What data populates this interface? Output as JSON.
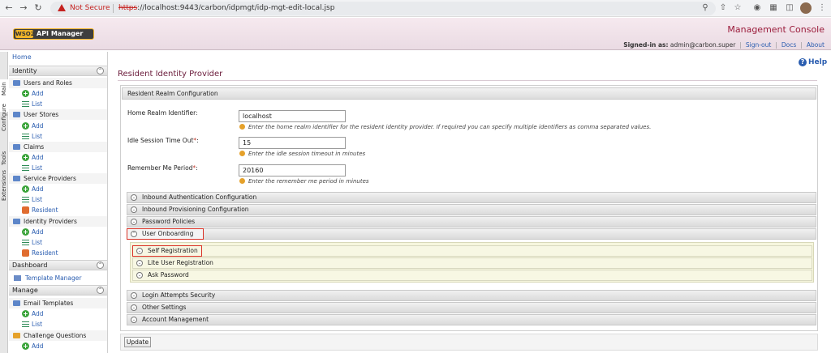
{
  "browser": {
    "not_secure": "Not Secure",
    "url_scheme": "https",
    "url_rest": "://localhost:9443/carbon/idpmgt/idp-mgt-edit-local.jsp"
  },
  "header": {
    "logo_wso2": "WSO2",
    "logo_product": "API Manager",
    "console_title": "Management Console",
    "signed_in_label": "Signed-in as:",
    "signed_in_user": "admin@carbon.super",
    "sign_out": "Sign-out",
    "docs": "Docs",
    "about": "About"
  },
  "vtabs": [
    "Main",
    "Configure",
    "Tools",
    "Extensions"
  ],
  "sidebar": {
    "home": "Home",
    "identity": "Identity",
    "users_and_roles": "Users and Roles",
    "user_stores": "User Stores",
    "claims": "Claims",
    "service_providers": "Service Providers",
    "identity_providers": "Identity Providers",
    "add": "Add",
    "list": "List",
    "resident": "Resident",
    "dashboard": "Dashboard",
    "template_manager": "Template Manager",
    "manage": "Manage",
    "email_templates": "Email Templates",
    "challenge_questions": "Challenge Questions"
  },
  "main": {
    "help": "Help",
    "page_title": "Resident Identity Provider",
    "panel_title": "Resident Realm Configuration",
    "home_realm_label": "Home Realm Identifier:",
    "home_realm_value": "localhost",
    "home_realm_hint": "Enter the home realm identifier for the resident identity provider. If required you can specify multiple identifiers as comma separated values.",
    "idle_label": "Idle Session Time Out",
    "idle_value": "15",
    "idle_hint": "Enter the idle session timeout in minutes",
    "remember_label": "Remember Me Period",
    "remember_value": "20160",
    "remember_hint": "Enter the remember me period in minutes",
    "required_mark": "*",
    "colon": ":",
    "sections": {
      "inbound_auth": "Inbound Authentication Configuration",
      "inbound_prov": "Inbound Provisioning Configuration",
      "password_policies": "Password Policies",
      "user_onboarding": "User Onboarding",
      "self_registration": "Self Registration",
      "lite_user_registration": "Lite User Registration",
      "ask_password": "Ask Password",
      "login_attempts": "Login Attempts Security",
      "other_settings": "Other Settings",
      "account_management": "Account Management"
    },
    "update": "Update"
  }
}
